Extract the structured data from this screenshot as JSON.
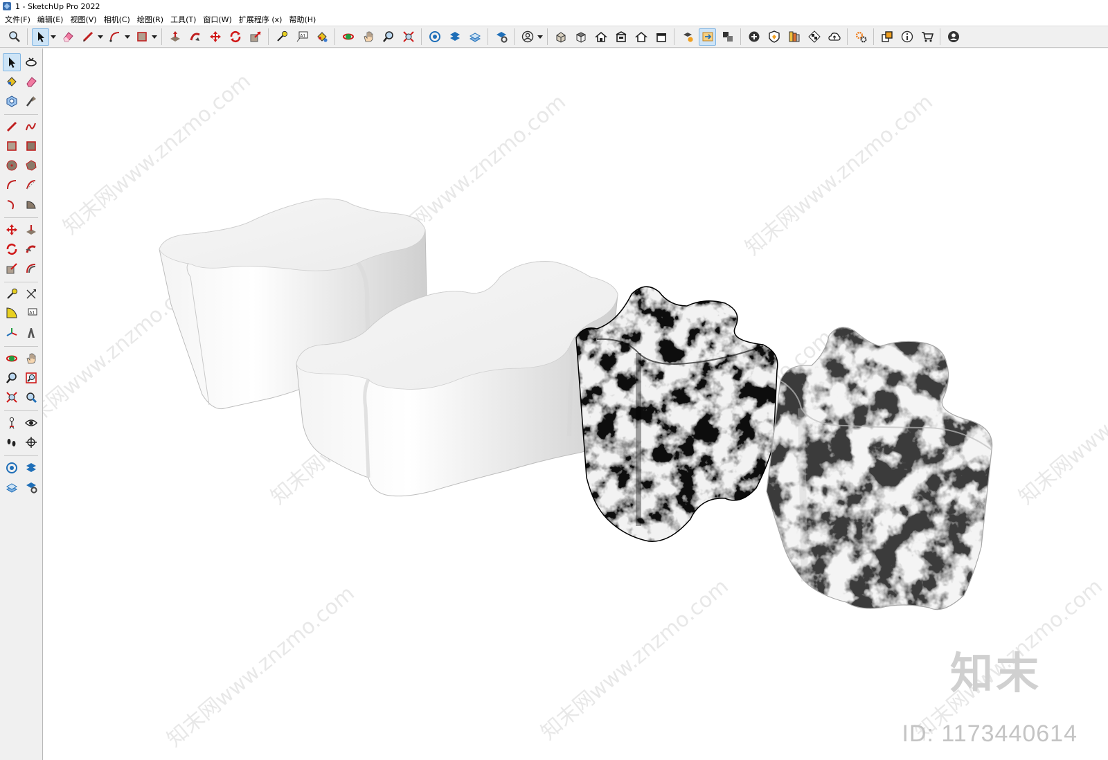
{
  "window": {
    "title": "1 - SketchUp Pro 2022",
    "app_icon": "sketchup-icon"
  },
  "menu": [
    {
      "label": "文件(F)"
    },
    {
      "label": "编辑(E)"
    },
    {
      "label": "视图(V)"
    },
    {
      "label": "相机(C)"
    },
    {
      "label": "绘图(R)"
    },
    {
      "label": "工具(T)"
    },
    {
      "label": "窗口(W)"
    },
    {
      "label": "扩展程序 (x)"
    },
    {
      "label": "帮助(H)"
    }
  ],
  "toolbar_icons": [
    "zoom-icon",
    "select-icon",
    "eraser-icon",
    "pencil-icon",
    "arc-icon",
    "rectangle-icon",
    "push-pull-icon",
    "follow-me-icon",
    "move-icon",
    "rotate-icon",
    "scale-icon",
    "tape-measure-icon",
    "text-icon",
    "paint-bucket-icon",
    "orbit-icon",
    "pan-icon",
    "zoom-tool-icon",
    "zoom-extents-icon",
    "warehouse-icon",
    "extension-warehouse-icon",
    "layout-icon",
    "ext-manager-icon",
    "user-icon",
    "iso-view-icon",
    "top-view-icon",
    "front-view-icon",
    "right-view-icon",
    "back-view-icon",
    "left-view-icon",
    "section-plane-icon",
    "section-display-icon",
    "section-cut-icon",
    "solid-union-icon",
    "solid-shell-icon",
    "material-icon",
    "shadows-icon",
    "cloud-icon",
    "settings-icon",
    "component-icon",
    "info-icon",
    "cart-icon",
    "account-icon"
  ],
  "left_toolbar_icons": [
    "select-icon",
    "orbit-icon",
    "paint-bucket-icon",
    "eraser-icon",
    "component-icon",
    "tape-measure-icon",
    "line-icon",
    "freehand-icon",
    "rectangle-icon",
    "rotated-rectangle-icon",
    "circle-icon",
    "polygon-icon",
    "arc-icon",
    "two-point-arc-icon",
    "three-point-arc-icon",
    "pie-icon",
    "move-icon",
    "push-pull-icon",
    "rotate-icon",
    "follow-me-icon",
    "scale-icon",
    "offset-icon",
    "tape-icon",
    "dimension-icon",
    "protractor-icon",
    "text-icon",
    "axes-icon",
    "3d-text-icon",
    "orbit-tool-icon",
    "pan-icon",
    "zoom-icon",
    "zoom-window-icon",
    "zoom-extents-icon",
    "previous-icon",
    "position-camera-icon",
    "look-around-icon",
    "walk-icon",
    "section-plane-icon",
    "warehouse-icon",
    "extension-icon",
    "layout-icon",
    "ext-manager-icon"
  ],
  "viewport": {
    "watermark_text": "知末网www.znzmo.com",
    "brand_logo": "知末",
    "brand_id": "ID: 1173440614",
    "objects": [
      {
        "name": "white-blob-stool-large",
        "material": "white"
      },
      {
        "name": "white-blob-stool-medium",
        "material": "white"
      },
      {
        "name": "black-marble-stool",
        "material": "black-marble"
      },
      {
        "name": "white-marble-stool",
        "material": "white-marble"
      }
    ]
  },
  "colors": {
    "toolbar_bg": "#f0f0f0",
    "active_button": "#cde4f7",
    "viewport_bg": "#ffffff",
    "watermark": "#d6d6d6"
  }
}
